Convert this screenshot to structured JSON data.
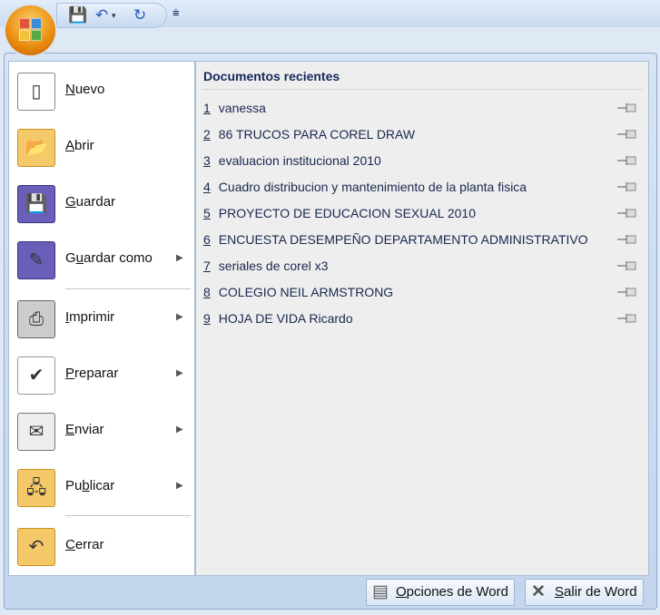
{
  "quick_access": {
    "save": "save-icon",
    "undo": "undo-icon",
    "redo": "redo-icon",
    "customize": "customize-icon"
  },
  "left_menu": [
    {
      "id": "nuevo",
      "pre": "",
      "key": "N",
      "post": "uevo",
      "submenu": false
    },
    {
      "id": "abrir",
      "pre": "",
      "key": "A",
      "post": "brir",
      "submenu": false
    },
    {
      "id": "guardar",
      "pre": "",
      "key": "G",
      "post": "uardar",
      "submenu": false
    },
    {
      "id": "guardar-como",
      "pre": "G",
      "key": "u",
      "post": "ardar como",
      "submenu": true
    },
    {
      "id": "imprimir",
      "pre": "",
      "key": "I",
      "post": "mprimir",
      "submenu": true
    },
    {
      "id": "preparar",
      "pre": "",
      "key": "P",
      "post": "reparar",
      "submenu": true
    },
    {
      "id": "enviar",
      "pre": "",
      "key": "E",
      "post": "nviar",
      "submenu": true
    },
    {
      "id": "publicar",
      "pre": "Pu",
      "key": "b",
      "post": "licar",
      "submenu": true
    },
    {
      "id": "cerrar",
      "pre": "",
      "key": "C",
      "post": "errar",
      "submenu": false
    }
  ],
  "recent": {
    "title": "Documentos recientes",
    "items": [
      {
        "num": "1",
        "name": "vanessa"
      },
      {
        "num": "2",
        "name": "86 TRUCOS PARA COREL DRAW"
      },
      {
        "num": "3",
        "name": "evaluacion institucional 2010"
      },
      {
        "num": "4",
        "name": "Cuadro distribucion y mantenimiento de la planta fisica"
      },
      {
        "num": "5",
        "name": "PROYECTO DE EDUCACION SEXUAL 2010"
      },
      {
        "num": "6",
        "name": "ENCUESTA DESEMPEÑO DEPARTAMENTO ADMINISTRATIVO"
      },
      {
        "num": "7",
        "name": "seriales de corel x3"
      },
      {
        "num": "8",
        "name": "COLEGIO NEIL ARMSTRONG"
      },
      {
        "num": "9",
        "name": "HOJA  DE VIDA Ricardo"
      }
    ]
  },
  "footer": {
    "options": {
      "key": "O",
      "post": "pciones de Word"
    },
    "exit": {
      "key": "S",
      "post": "alir de Word"
    }
  }
}
